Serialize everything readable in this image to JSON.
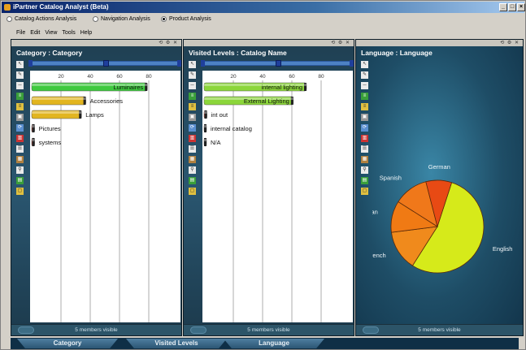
{
  "window": {
    "title": "iPartner Catalog Analyst (Beta)"
  },
  "modes": [
    {
      "label": "Catalog Actions Analysis",
      "selected": false
    },
    {
      "label": "Navigation Analysis",
      "selected": false
    },
    {
      "label": "Product Analysis",
      "selected": true
    }
  ],
  "menu": [
    "File",
    "Edit",
    "View",
    "Tools",
    "Help"
  ],
  "panels": [
    {
      "title": "Category : Category",
      "footer": "5 members visible"
    },
    {
      "title": "Visited Levels : Catalog Name",
      "footer": "5 members visible"
    },
    {
      "title": "Language : Language",
      "footer": "5 members visible"
    }
  ],
  "tabs": [
    "Category",
    "Visited Levels",
    "Language"
  ],
  "chart_data": [
    {
      "type": "bar",
      "orientation": "horizontal",
      "categories": [
        "Luminaires",
        "Accessories",
        "Lamps",
        "Pictures",
        "systems"
      ],
      "values": [
        79,
        37,
        34,
        2,
        2
      ],
      "colors": [
        "#3fc93f",
        "#e2b520",
        "#e2b520",
        "#c0392b",
        "#c0392b"
      ],
      "xticks": [
        20,
        40,
        60,
        80
      ],
      "xlim": [
        0,
        95
      ]
    },
    {
      "type": "bar",
      "orientation": "horizontal",
      "categories": [
        "internal lighting",
        "External Lighting",
        "int out",
        "internal catalog",
        "N/A"
      ],
      "values": [
        70,
        61,
        2,
        0.5,
        0.5
      ],
      "colors": [
        "#8bd63a",
        "#8bd63a",
        "#c0392b",
        "#9aa0a6",
        "#9aa0a6"
      ],
      "xticks": [
        20,
        40,
        60,
        80
      ],
      "xlim": [
        0,
        95
      ]
    },
    {
      "type": "pie",
      "categories": [
        "English",
        "French",
        "Italian",
        "Spanish",
        "German"
      ],
      "values": [
        54,
        14,
        11,
        12,
        9
      ],
      "colors": [
        "#d6ea1a",
        "#f08a1c",
        "#f07a14",
        "#f0781a",
        "#e84a14"
      ]
    }
  ]
}
